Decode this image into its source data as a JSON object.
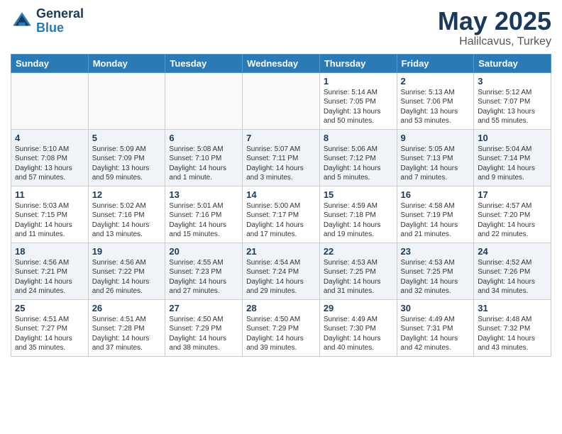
{
  "header": {
    "logo_general": "General",
    "logo_blue": "Blue",
    "month": "May 2025",
    "location": "Halilcavus, Turkey"
  },
  "weekdays": [
    "Sunday",
    "Monday",
    "Tuesday",
    "Wednesday",
    "Thursday",
    "Friday",
    "Saturday"
  ],
  "weeks": [
    [
      {
        "day": "",
        "info": ""
      },
      {
        "day": "",
        "info": ""
      },
      {
        "day": "",
        "info": ""
      },
      {
        "day": "",
        "info": ""
      },
      {
        "day": "1",
        "info": "Sunrise: 5:14 AM\nSunset: 7:05 PM\nDaylight: 13 hours\nand 50 minutes."
      },
      {
        "day": "2",
        "info": "Sunrise: 5:13 AM\nSunset: 7:06 PM\nDaylight: 13 hours\nand 53 minutes."
      },
      {
        "day": "3",
        "info": "Sunrise: 5:12 AM\nSunset: 7:07 PM\nDaylight: 13 hours\nand 55 minutes."
      }
    ],
    [
      {
        "day": "4",
        "info": "Sunrise: 5:10 AM\nSunset: 7:08 PM\nDaylight: 13 hours\nand 57 minutes."
      },
      {
        "day": "5",
        "info": "Sunrise: 5:09 AM\nSunset: 7:09 PM\nDaylight: 13 hours\nand 59 minutes."
      },
      {
        "day": "6",
        "info": "Sunrise: 5:08 AM\nSunset: 7:10 PM\nDaylight: 14 hours\nand 1 minute."
      },
      {
        "day": "7",
        "info": "Sunrise: 5:07 AM\nSunset: 7:11 PM\nDaylight: 14 hours\nand 3 minutes."
      },
      {
        "day": "8",
        "info": "Sunrise: 5:06 AM\nSunset: 7:12 PM\nDaylight: 14 hours\nand 5 minutes."
      },
      {
        "day": "9",
        "info": "Sunrise: 5:05 AM\nSunset: 7:13 PM\nDaylight: 14 hours\nand 7 minutes."
      },
      {
        "day": "10",
        "info": "Sunrise: 5:04 AM\nSunset: 7:14 PM\nDaylight: 14 hours\nand 9 minutes."
      }
    ],
    [
      {
        "day": "11",
        "info": "Sunrise: 5:03 AM\nSunset: 7:15 PM\nDaylight: 14 hours\nand 11 minutes."
      },
      {
        "day": "12",
        "info": "Sunrise: 5:02 AM\nSunset: 7:16 PM\nDaylight: 14 hours\nand 13 minutes."
      },
      {
        "day": "13",
        "info": "Sunrise: 5:01 AM\nSunset: 7:16 PM\nDaylight: 14 hours\nand 15 minutes."
      },
      {
        "day": "14",
        "info": "Sunrise: 5:00 AM\nSunset: 7:17 PM\nDaylight: 14 hours\nand 17 minutes."
      },
      {
        "day": "15",
        "info": "Sunrise: 4:59 AM\nSunset: 7:18 PM\nDaylight: 14 hours\nand 19 minutes."
      },
      {
        "day": "16",
        "info": "Sunrise: 4:58 AM\nSunset: 7:19 PM\nDaylight: 14 hours\nand 21 minutes."
      },
      {
        "day": "17",
        "info": "Sunrise: 4:57 AM\nSunset: 7:20 PM\nDaylight: 14 hours\nand 22 minutes."
      }
    ],
    [
      {
        "day": "18",
        "info": "Sunrise: 4:56 AM\nSunset: 7:21 PM\nDaylight: 14 hours\nand 24 minutes."
      },
      {
        "day": "19",
        "info": "Sunrise: 4:56 AM\nSunset: 7:22 PM\nDaylight: 14 hours\nand 26 minutes."
      },
      {
        "day": "20",
        "info": "Sunrise: 4:55 AM\nSunset: 7:23 PM\nDaylight: 14 hours\nand 27 minutes."
      },
      {
        "day": "21",
        "info": "Sunrise: 4:54 AM\nSunset: 7:24 PM\nDaylight: 14 hours\nand 29 minutes."
      },
      {
        "day": "22",
        "info": "Sunrise: 4:53 AM\nSunset: 7:25 PM\nDaylight: 14 hours\nand 31 minutes."
      },
      {
        "day": "23",
        "info": "Sunrise: 4:53 AM\nSunset: 7:25 PM\nDaylight: 14 hours\nand 32 minutes."
      },
      {
        "day": "24",
        "info": "Sunrise: 4:52 AM\nSunset: 7:26 PM\nDaylight: 14 hours\nand 34 minutes."
      }
    ],
    [
      {
        "day": "25",
        "info": "Sunrise: 4:51 AM\nSunset: 7:27 PM\nDaylight: 14 hours\nand 35 minutes."
      },
      {
        "day": "26",
        "info": "Sunrise: 4:51 AM\nSunset: 7:28 PM\nDaylight: 14 hours\nand 37 minutes."
      },
      {
        "day": "27",
        "info": "Sunrise: 4:50 AM\nSunset: 7:29 PM\nDaylight: 14 hours\nand 38 minutes."
      },
      {
        "day": "28",
        "info": "Sunrise: 4:50 AM\nSunset: 7:29 PM\nDaylight: 14 hours\nand 39 minutes."
      },
      {
        "day": "29",
        "info": "Sunrise: 4:49 AM\nSunset: 7:30 PM\nDaylight: 14 hours\nand 40 minutes."
      },
      {
        "day": "30",
        "info": "Sunrise: 4:49 AM\nSunset: 7:31 PM\nDaylight: 14 hours\nand 42 minutes."
      },
      {
        "day": "31",
        "info": "Sunrise: 4:48 AM\nSunset: 7:32 PM\nDaylight: 14 hours\nand 43 minutes."
      }
    ]
  ]
}
